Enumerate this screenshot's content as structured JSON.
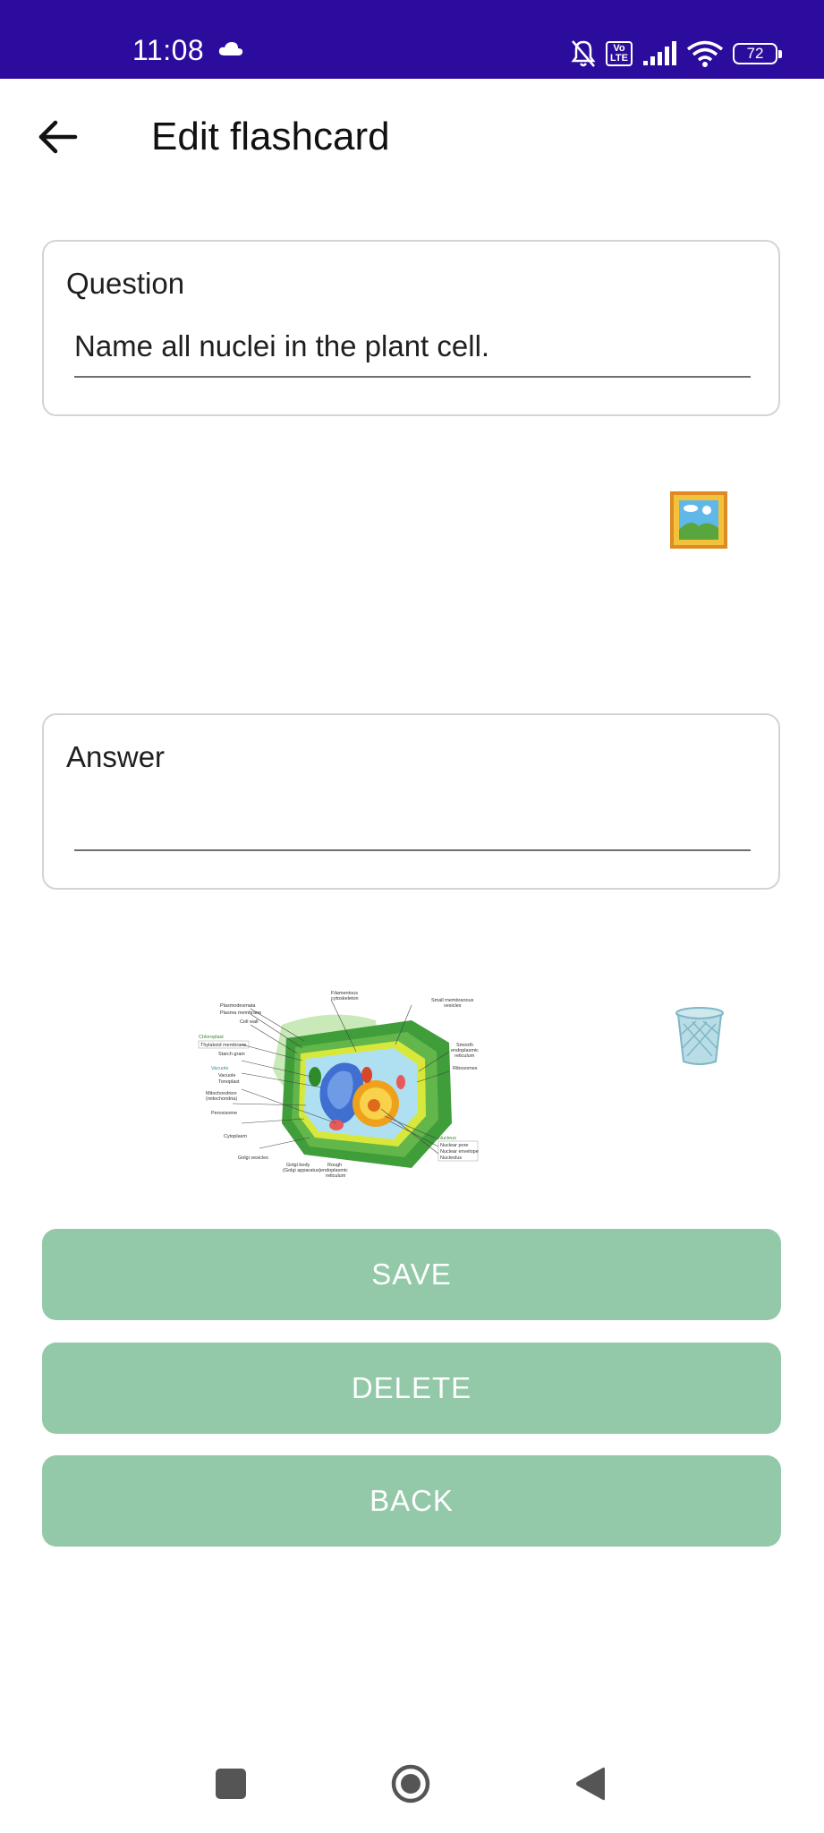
{
  "status_bar": {
    "time": "11:08",
    "battery": "72",
    "volte_label": "Vo\nLTE",
    "icons": [
      "cloud-icon",
      "mute-bell-icon",
      "volte-icon",
      "signal-icon",
      "wifi-icon",
      "battery-icon"
    ],
    "background_color": "#2c0c9c"
  },
  "app_bar": {
    "title": "Edit flashcard",
    "back_icon": "arrow-left-icon"
  },
  "question": {
    "label": "Question",
    "value": "Name all nuclei in the plant cell."
  },
  "answer": {
    "label": "Answer",
    "value": ""
  },
  "question_image_picker_icon": "framed-picture-icon",
  "answer_image": {
    "description_icon": "plant-cell-diagram",
    "labels": [
      "Plasmodesmata",
      "Plasma membrane",
      "Cell wall",
      "Chloroplast",
      "Thylakoid membrane",
      "Starch grain",
      "Vacuole",
      "Tonoplast",
      "Mitochondrion (mitochondria)",
      "Peroxisome",
      "Cytoplasm",
      "Golgi vesicles",
      "Golgi body (Golgi apparatus)",
      "Rough endoplasmic reticulum",
      "Filamentous cytoskeleton",
      "Small membranous vesicles",
      "Smooth endoplasmic reticulum",
      "Ribosomes",
      "Nucleus",
      "Nuclear pore",
      "Nuclear envelope",
      "Nucleolus"
    ]
  },
  "delete_image_icon": "trash-can-icon",
  "buttons": {
    "save": "SAVE",
    "delete": "DELETE",
    "back": "BACK",
    "color": "#93c9a8"
  },
  "nav_bar": {
    "icons": [
      "recents-square-icon",
      "home-circle-icon",
      "back-triangle-icon"
    ]
  }
}
